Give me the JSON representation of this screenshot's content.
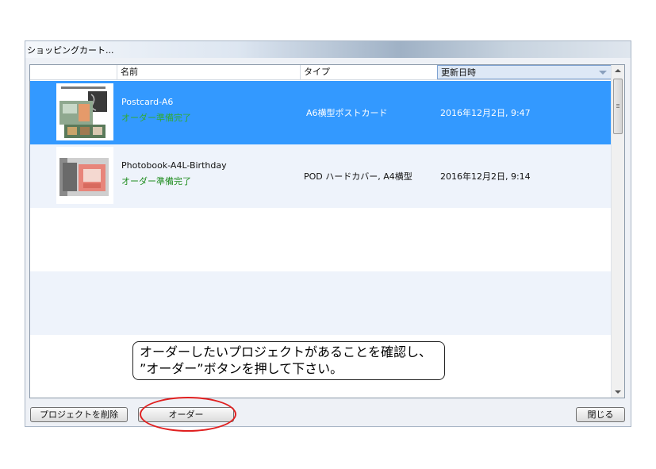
{
  "window": {
    "title": "ショッピングカート..."
  },
  "columns": {
    "name": "名前",
    "type": "タイプ",
    "date": "更新日時"
  },
  "rows": [
    {
      "name": "Postcard-A6",
      "status": "オーダー準備完了",
      "type": "A6横型ポストカード",
      "date": "2016年12月2日, 9:47",
      "selected": true
    },
    {
      "name": "Photobook-A4L-Birthday",
      "status": "オーダー準備完了",
      "type": "POD ハードカバー, A4横型",
      "date": "2016年12月2日, 9:14",
      "selected": false
    }
  ],
  "callout": {
    "line1": "オーダーしたいプロジェクトがあることを確認し、",
    "line2": "”オーダー”ボタンを押して下さい。"
  },
  "buttons": {
    "delete": "プロジェクトを削除",
    "order": "オーダー",
    "close": "閉じる"
  },
  "colors": {
    "selection": "#3399ff",
    "status_green": "#1e8c1e",
    "annotation_red": "#e02020"
  }
}
